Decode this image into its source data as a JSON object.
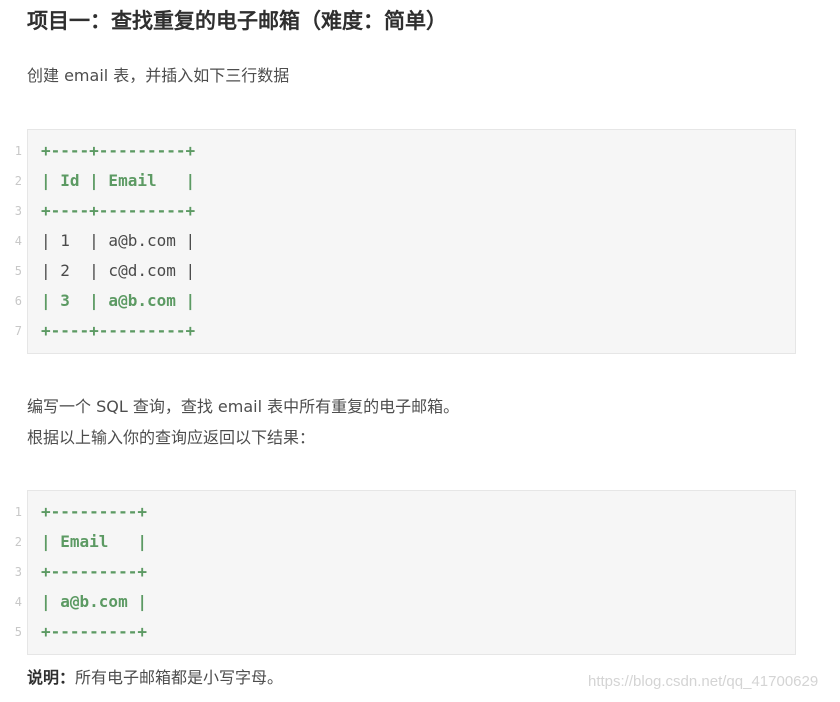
{
  "title": "项目一：查找重复的电子邮箱（难度：简单）",
  "intro": "创建 email 表，并插入如下三行数据",
  "table_block": {
    "lines": [
      {
        "no": "1",
        "text": "+----+---------+",
        "style": "hl"
      },
      {
        "no": "2",
        "text": "| Id | Email   |",
        "style": "hl"
      },
      {
        "no": "3",
        "text": "+----+---------+",
        "style": "hl"
      },
      {
        "no": "4",
        "text": "| 1  | a@b.com |",
        "style": "plain"
      },
      {
        "no": "5",
        "text": "| 2  | c@d.com |",
        "style": "plain"
      },
      {
        "no": "6",
        "text": "| 3  | a@b.com |",
        "style": "hl"
      },
      {
        "no": "7",
        "text": "+----+---------+",
        "style": "hl"
      }
    ]
  },
  "task_line1": "编写一个 SQL 查询，查找 email 表中所有重复的电子邮箱。",
  "task_line2": "根据以上输入你的查询应返回以下结果：",
  "result_block": {
    "lines": [
      {
        "no": "1",
        "text": "+---------+",
        "style": "hl"
      },
      {
        "no": "2",
        "text": "| Email   |",
        "style": "hl"
      },
      {
        "no": "3",
        "text": "+---------+",
        "style": "hl"
      },
      {
        "no": "4",
        "text": "| a@b.com |",
        "style": "hl"
      },
      {
        "no": "5",
        "text": "+---------+",
        "style": "hl"
      }
    ]
  },
  "note": {
    "label": "说明：",
    "text": "所有电子邮箱都是小写字母。"
  },
  "watermark": "https://blog.csdn.net/qq_41700629"
}
